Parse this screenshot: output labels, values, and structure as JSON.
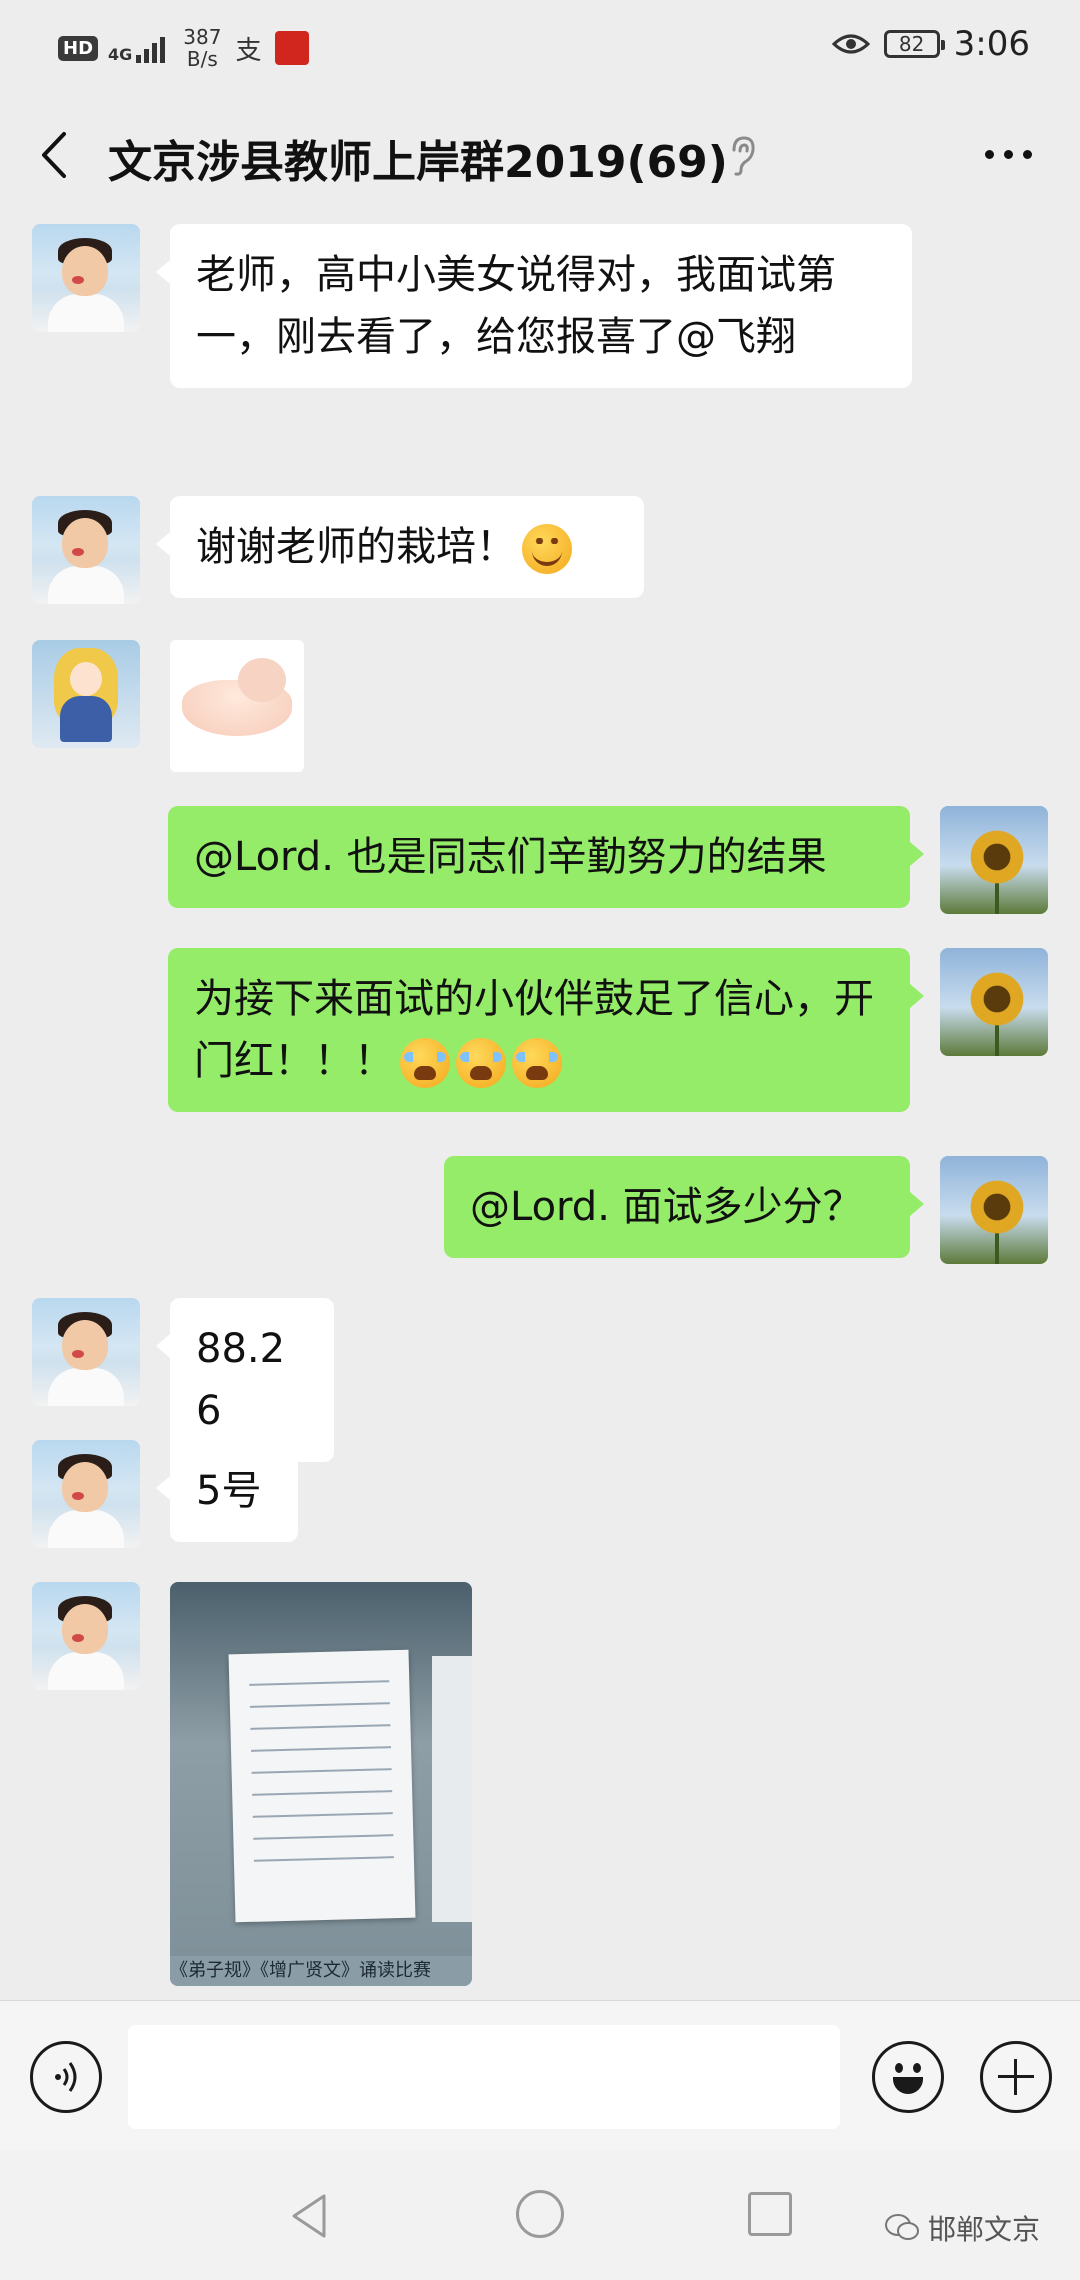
{
  "status_bar": {
    "hd": "HD",
    "network": "4G",
    "speed_value": "387",
    "speed_unit": "B/s",
    "battery": "82",
    "time": "3:06"
  },
  "header": {
    "title": "文京涉县教师上岸群2019(69)"
  },
  "messages": [
    {
      "side": "in",
      "sender_avatar": "kid-avatar",
      "text": "老师，高中小美女说得对，我面试第一，刚去看了，给您报喜了@飞翔"
    },
    {
      "side": "in",
      "sender_avatar": "kid-avatar",
      "text": "谢谢老师的栽培！",
      "emoji": "smile-emoji"
    },
    {
      "side": "in",
      "sender_avatar": "anime-avatar",
      "type": "sticker",
      "sticker": "cupped-hands-sticker"
    },
    {
      "side": "out",
      "sender_avatar": "sunflower-avatar",
      "text": "@Lord. 也是同志们辛勤努力的结果"
    },
    {
      "side": "out",
      "sender_avatar": "sunflower-avatar",
      "text": "为接下来面试的小伙伴鼓足了信心，开门红！！！",
      "emoji": "crying-laughing-emoji x3"
    },
    {
      "side": "out",
      "sender_avatar": "sunflower-avatar",
      "text": "@Lord. 面试多少分？"
    },
    {
      "side": "in",
      "sender_avatar": "kid-avatar",
      "text": "88.26"
    },
    {
      "side": "in",
      "sender_avatar": "kid-avatar",
      "text": "5号"
    },
    {
      "side": "in",
      "sender_avatar": "kid-avatar",
      "type": "image",
      "image_caption": "《弟子规》《增广贤文》诵读比赛"
    }
  ],
  "watermark": {
    "text": "邯郸文京"
  },
  "colors": {
    "background": "#ededed",
    "incoming_bubble": "#ffffff",
    "outgoing_bubble": "#95ec69"
  }
}
